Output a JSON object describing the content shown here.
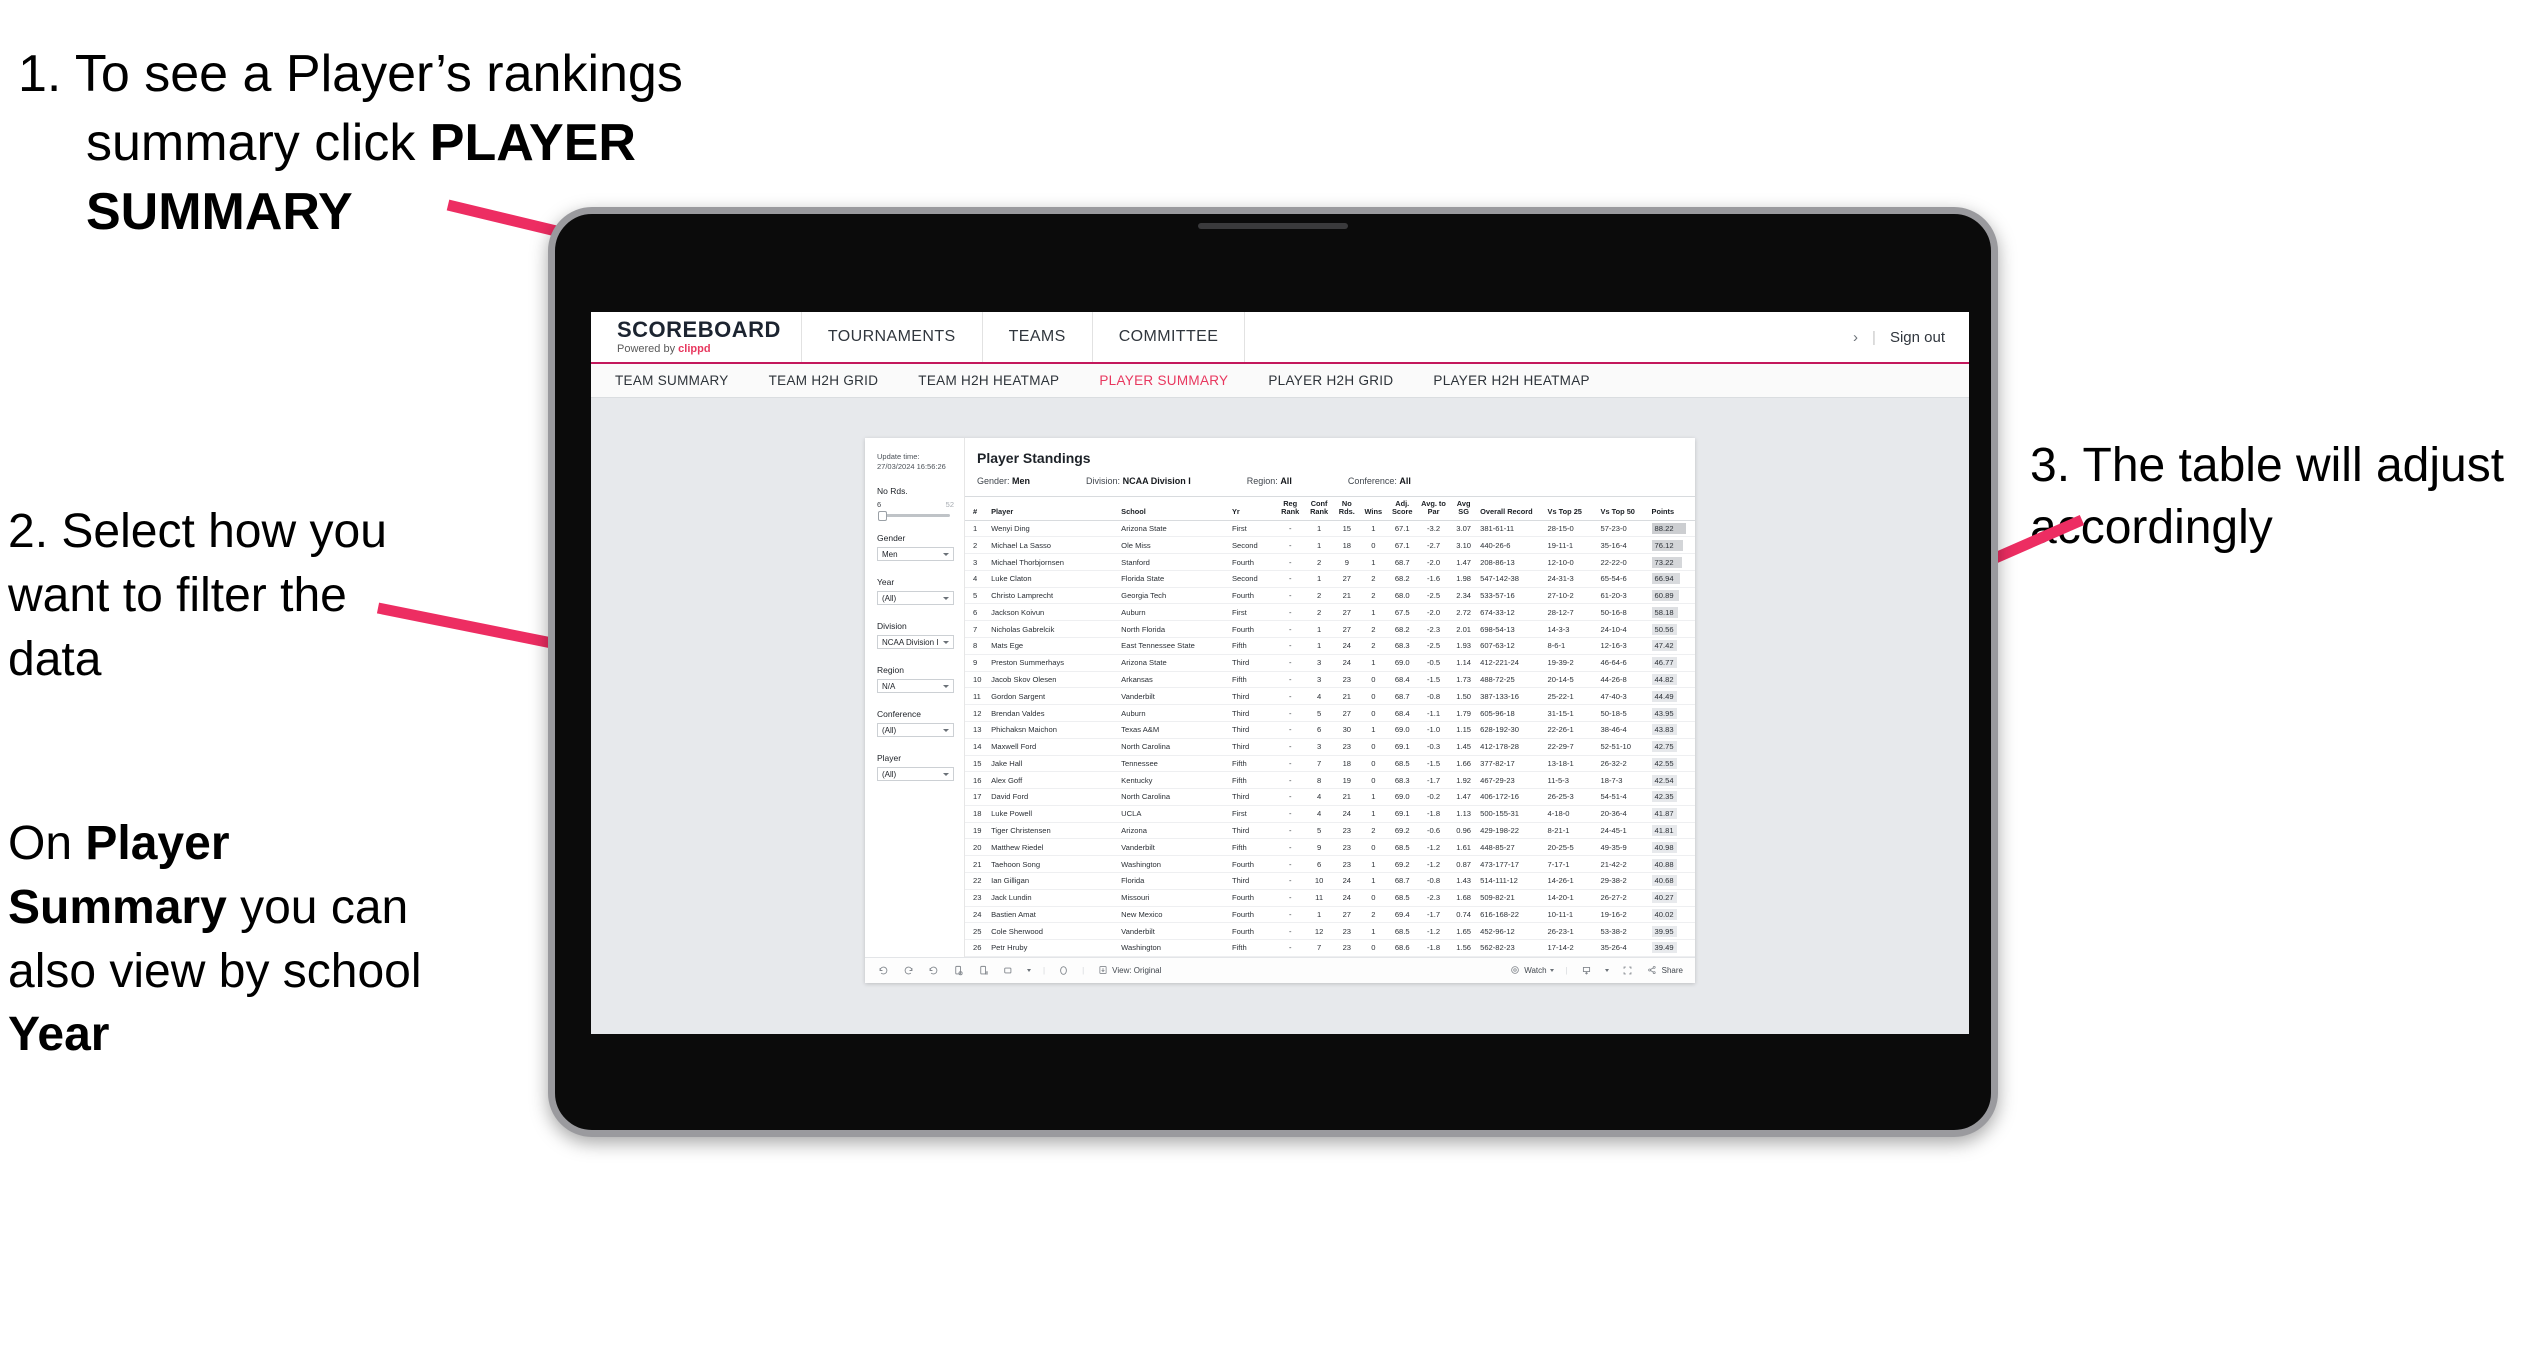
{
  "annotations": {
    "note1_prefix": "1.",
    "note1_text_a": "To see a Player’s rankings summary click ",
    "note1_bold": "PLAYER SUMMARY",
    "note2_text": "2. Select how you want to filter the data",
    "note2b_a": "On ",
    "note2b_bold1": "Player Summary",
    "note2b_b": " you can also view by school ",
    "note2b_bold2": "Year",
    "note3_text": "3. The table will adjust accordingly",
    "arrow_color": "#ED2D62"
  },
  "app": {
    "brand": {
      "logo": "SCOREBOARD",
      "powered_prefix": "Powered by ",
      "powered_brand": "clippd"
    },
    "topnav": [
      "TOURNAMENTS",
      "TEAMS",
      "COMMITTEE"
    ],
    "account": {
      "chevron": "›",
      "divider": "|",
      "signout": "Sign out"
    },
    "subtabs": [
      {
        "label": "TEAM SUMMARY",
        "active": false
      },
      {
        "label": "TEAM H2H GRID",
        "active": false
      },
      {
        "label": "TEAM H2H HEATMAP",
        "active": false
      },
      {
        "label": "PLAYER SUMMARY",
        "active": true
      },
      {
        "label": "PLAYER H2H GRID",
        "active": false
      },
      {
        "label": "PLAYER H2H HEATMAP",
        "active": false
      }
    ],
    "accent_color": "#E8375E"
  },
  "dashboard": {
    "update_time_label": "Update time:",
    "update_time_value": "27/03/2024 16:56:26",
    "title": "Player Standings",
    "summary_filters": [
      {
        "label": "Gender:",
        "value": "Men"
      },
      {
        "label": "Division:",
        "value": "NCAA Division I"
      },
      {
        "label": "Region:",
        "value": "All"
      },
      {
        "label": "Conference:",
        "value": "All"
      }
    ],
    "filters": {
      "no_rds": {
        "label": "No Rds.",
        "min": "6",
        "max": "52"
      },
      "selects": [
        {
          "label": "Gender",
          "value": "Men"
        },
        {
          "label": "Year",
          "value": "(All)"
        },
        {
          "label": "Division",
          "value": "NCAA Division I"
        },
        {
          "label": "Region",
          "value": "N/A"
        },
        {
          "label": "Conference",
          "value": "(All)"
        },
        {
          "label": "Player",
          "value": "(All)"
        }
      ]
    },
    "toolbar": {
      "view_label": "View: Original",
      "watch_label": "Watch",
      "share_label": "Share"
    }
  },
  "chart_data": {
    "type": "table",
    "title": "Player Standings",
    "columns": [
      "#",
      "Player",
      "School",
      "Yr",
      "Reg Rank",
      "Conf Rank",
      "No Rds.",
      "Wins",
      "Adj. Score",
      "Avg. to Par",
      "Avg SG",
      "Overall Record",
      "Vs Top 25",
      "Vs Top 50",
      "Points"
    ],
    "rows": [
      [
        "1",
        "Wenyi Ding",
        "Arizona State",
        "First",
        "-",
        "1",
        "15",
        "1",
        "67.1",
        "-3.2",
        "3.07",
        "381-61-11",
        "28-15-0",
        "57-23-0",
        "88.22"
      ],
      [
        "2",
        "Michael La Sasso",
        "Ole Miss",
        "Second",
        "-",
        "1",
        "18",
        "0",
        "67.1",
        "-2.7",
        "3.10",
        "440-26-6",
        "19-11-1",
        "35-16-4",
        "76.12"
      ],
      [
        "3",
        "Michael Thorbjornsen",
        "Stanford",
        "Fourth",
        "-",
        "2",
        "9",
        "1",
        "68.7",
        "-2.0",
        "1.47",
        "208-86-13",
        "12-10-0",
        "22-22-0",
        "73.22"
      ],
      [
        "4",
        "Luke Claton",
        "Florida State",
        "Second",
        "-",
        "1",
        "27",
        "2",
        "68.2",
        "-1.6",
        "1.98",
        "547-142-38",
        "24-31-3",
        "65-54-6",
        "66.94"
      ],
      [
        "5",
        "Christo Lamprecht",
        "Georgia Tech",
        "Fourth",
        "-",
        "2",
        "21",
        "2",
        "68.0",
        "-2.5",
        "2.34",
        "533-57-16",
        "27-10-2",
        "61-20-3",
        "60.89"
      ],
      [
        "6",
        "Jackson Koivun",
        "Auburn",
        "First",
        "-",
        "2",
        "27",
        "1",
        "67.5",
        "-2.0",
        "2.72",
        "674-33-12",
        "28-12-7",
        "50-16-8",
        "58.18"
      ],
      [
        "7",
        "Nicholas Gabrelcik",
        "North Florida",
        "Fourth",
        "-",
        "1",
        "27",
        "2",
        "68.2",
        "-2.3",
        "2.01",
        "698-54-13",
        "14-3-3",
        "24-10-4",
        "50.56"
      ],
      [
        "8",
        "Mats Ege",
        "East Tennessee State",
        "Fifth",
        "-",
        "1",
        "24",
        "2",
        "68.3",
        "-2.5",
        "1.93",
        "607-63-12",
        "8-6-1",
        "12-16-3",
        "47.42"
      ],
      [
        "9",
        "Preston Summerhays",
        "Arizona State",
        "Third",
        "-",
        "3",
        "24",
        "1",
        "69.0",
        "-0.5",
        "1.14",
        "412-221-24",
        "19-39-2",
        "46-64-6",
        "46.77"
      ],
      [
        "10",
        "Jacob Skov Olesen",
        "Arkansas",
        "Fifth",
        "-",
        "3",
        "23",
        "0",
        "68.4",
        "-1.5",
        "1.73",
        "488-72-25",
        "20-14-5",
        "44-26-8",
        "44.82"
      ],
      [
        "11",
        "Gordon Sargent",
        "Vanderbilt",
        "Third",
        "-",
        "4",
        "21",
        "0",
        "68.7",
        "-0.8",
        "1.50",
        "387-133-16",
        "25-22-1",
        "47-40-3",
        "44.49"
      ],
      [
        "12",
        "Brendan Valdes",
        "Auburn",
        "Third",
        "-",
        "5",
        "27",
        "0",
        "68.4",
        "-1.1",
        "1.79",
        "605-96-18",
        "31-15-1",
        "50-18-5",
        "43.95"
      ],
      [
        "13",
        "Phichaksn Maichon",
        "Texas A&M",
        "Third",
        "-",
        "6",
        "30",
        "1",
        "69.0",
        "-1.0",
        "1.15",
        "628-192-30",
        "22-26-1",
        "38-46-4",
        "43.83"
      ],
      [
        "14",
        "Maxwell Ford",
        "North Carolina",
        "Third",
        "-",
        "3",
        "23",
        "0",
        "69.1",
        "-0.3",
        "1.45",
        "412-178-28",
        "22-29-7",
        "52-51-10",
        "42.75"
      ],
      [
        "15",
        "Jake Hall",
        "Tennessee",
        "Fifth",
        "-",
        "7",
        "18",
        "0",
        "68.5",
        "-1.5",
        "1.66",
        "377-82-17",
        "13-18-1",
        "26-32-2",
        "42.55"
      ],
      [
        "16",
        "Alex Goff",
        "Kentucky",
        "Fifth",
        "-",
        "8",
        "19",
        "0",
        "68.3",
        "-1.7",
        "1.92",
        "467-29-23",
        "11-5-3",
        "18-7-3",
        "42.54"
      ],
      [
        "17",
        "David Ford",
        "North Carolina",
        "Third",
        "-",
        "4",
        "21",
        "1",
        "69.0",
        "-0.2",
        "1.47",
        "406-172-16",
        "26-25-3",
        "54-51-4",
        "42.35"
      ],
      [
        "18",
        "Luke Powell",
        "UCLA",
        "First",
        "-",
        "4",
        "24",
        "1",
        "69.1",
        "-1.8",
        "1.13",
        "500-155-31",
        "4-18-0",
        "20-36-4",
        "41.87"
      ],
      [
        "19",
        "Tiger Christensen",
        "Arizona",
        "Third",
        "-",
        "5",
        "23",
        "2",
        "69.2",
        "-0.6",
        "0.96",
        "429-198-22",
        "8-21-1",
        "24-45-1",
        "41.81"
      ],
      [
        "20",
        "Matthew Riedel",
        "Vanderbilt",
        "Fifth",
        "-",
        "9",
        "23",
        "0",
        "68.5",
        "-1.2",
        "1.61",
        "448-85-27",
        "20-25-5",
        "49-35-9",
        "40.98"
      ],
      [
        "21",
        "Taehoon Song",
        "Washington",
        "Fourth",
        "-",
        "6",
        "23",
        "1",
        "69.2",
        "-1.2",
        "0.87",
        "473-177-17",
        "7-17-1",
        "21-42-2",
        "40.88"
      ],
      [
        "22",
        "Ian Gilligan",
        "Florida",
        "Third",
        "-",
        "10",
        "24",
        "1",
        "68.7",
        "-0.8",
        "1.43",
        "514-111-12",
        "14-26-1",
        "29-38-2",
        "40.68"
      ],
      [
        "23",
        "Jack Lundin",
        "Missouri",
        "Fourth",
        "-",
        "11",
        "24",
        "0",
        "68.5",
        "-2.3",
        "1.68",
        "509-82-21",
        "14-20-1",
        "26-27-2",
        "40.27"
      ],
      [
        "24",
        "Bastien Amat",
        "New Mexico",
        "Fourth",
        "-",
        "1",
        "27",
        "2",
        "69.4",
        "-1.7",
        "0.74",
        "616-168-22",
        "10-11-1",
        "19-16-2",
        "40.02"
      ],
      [
        "25",
        "Cole Sherwood",
        "Vanderbilt",
        "Fourth",
        "-",
        "12",
        "23",
        "1",
        "68.5",
        "-1.2",
        "1.65",
        "452-96-12",
        "26-23-1",
        "53-38-2",
        "39.95"
      ],
      [
        "26",
        "Petr Hruby",
        "Washington",
        "Fifth",
        "-",
        "7",
        "23",
        "0",
        "68.6",
        "-1.8",
        "1.56",
        "562-82-23",
        "17-14-2",
        "35-26-4",
        "39.49"
      ]
    ],
    "points_max": 88.22,
    "points_min": 39.49
  }
}
